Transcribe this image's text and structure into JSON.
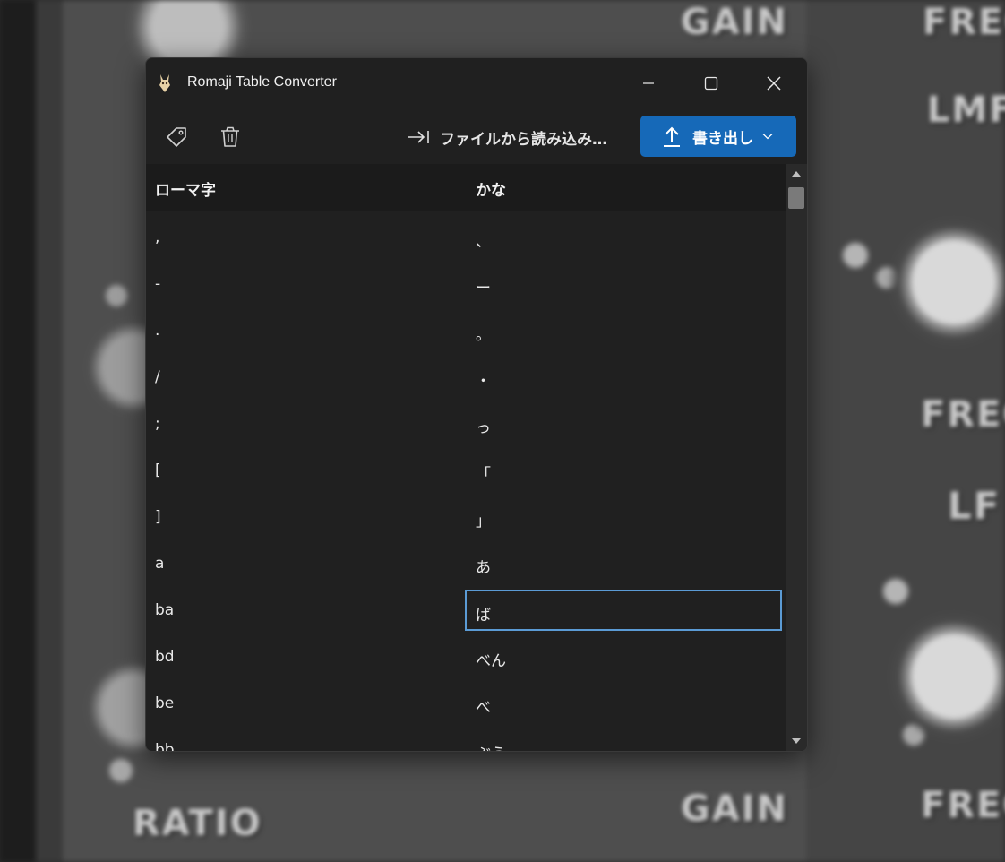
{
  "window": {
    "title": "Romaji Table Converter"
  },
  "toolbar": {
    "tag_icon": "tag-icon",
    "trash_icon": "trash-icon",
    "import_label": "ファイルから読み込み…",
    "export_label": "書き出し"
  },
  "table": {
    "headers": [
      "ローマ字",
      "かな"
    ],
    "rows": [
      [
        ",",
        "、"
      ],
      [
        "-",
        "ー"
      ],
      [
        ".",
        "。"
      ],
      [
        "/",
        "・"
      ],
      [
        ";",
        "っ"
      ],
      [
        "[",
        "「"
      ],
      [
        "]",
        "」"
      ],
      [
        "a",
        "あ"
      ],
      [
        "ba",
        "ば"
      ],
      [
        "bd",
        "べん"
      ],
      [
        "be",
        "べ"
      ],
      [
        "bb",
        "ぶう"
      ]
    ],
    "selected_row": 8
  },
  "background_labels": [
    "GAIN",
    "FREQ",
    "LMF",
    "FREQ",
    "LF",
    "GAIN",
    "FREQ",
    "RATIO"
  ],
  "colors": {
    "accent": "#1669b8",
    "selection": "#5b9bd5",
    "window_bg": "#202020"
  }
}
